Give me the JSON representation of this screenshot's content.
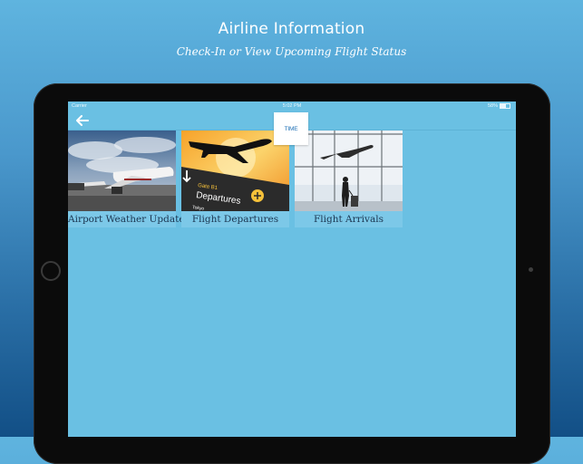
{
  "header": {
    "title": "Airline Information",
    "subtitle": "Check-In or View Upcoming Flight Status"
  },
  "status_bar": {
    "carrier": "Carrier",
    "time": "5:02 PM",
    "battery": "58%"
  },
  "nav": {
    "back_icon": "back-arrow-icon",
    "logo_text": "TIME"
  },
  "tiles": [
    {
      "label": "Airport Weather Update",
      "image": "plane-at-gate-photo"
    },
    {
      "label": "Flight Departures",
      "image": "departures-sign-sunset-photo"
    },
    {
      "label": "Flight Arrivals",
      "image": "traveler-at-terminal-window-photo"
    }
  ],
  "colors": {
    "screen_bg": "#6ac0e3",
    "tile_label_bg": "#7cc8e8",
    "tile_label_text": "#1b3550"
  }
}
